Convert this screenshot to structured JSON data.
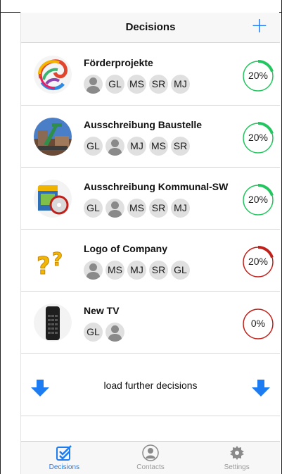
{
  "navbar": {
    "title": "Decisions",
    "add_label": "+"
  },
  "decisions": [
    {
      "name": "Förderprojekte",
      "participants": [
        "person",
        "GL",
        "MS",
        "SR",
        "MJ"
      ],
      "progress_label": "20%",
      "progress": 0.2,
      "color": "#22c55e"
    },
    {
      "name": "Ausschreibung Baustelle",
      "participants": [
        "GL",
        "person",
        "MJ",
        "MS",
        "SR"
      ],
      "progress_label": "20%",
      "progress": 0.2,
      "color": "#22c55e"
    },
    {
      "name": "Ausschreibung Kommunal-SW",
      "participants": [
        "GL",
        "person",
        "MS",
        "SR",
        "MJ"
      ],
      "progress_label": "20%",
      "progress": 0.2,
      "color": "#22c55e"
    },
    {
      "name": "Logo of Company",
      "participants": [
        "person",
        "MS",
        "MJ",
        "SR",
        "GL"
      ],
      "progress_label": "20%",
      "progress": 0.2,
      "color": "#c0201a"
    },
    {
      "name": "New TV",
      "participants": [
        "GL",
        "person"
      ],
      "progress_label": "0%",
      "progress": 0.0,
      "color": "#c0201a"
    }
  ],
  "loadmore": {
    "label": "load further decisions"
  },
  "tabbar": {
    "tabs": [
      {
        "label": "Decisions",
        "icon": "checklist-icon",
        "active": true
      },
      {
        "label": "Contacts",
        "icon": "contact-icon",
        "active": false
      },
      {
        "label": "Settings",
        "icon": "gear-icon",
        "active": false
      }
    ]
  },
  "colors": {
    "accent": "#1e7cf2",
    "green": "#22c55e",
    "red": "#c0201a"
  }
}
